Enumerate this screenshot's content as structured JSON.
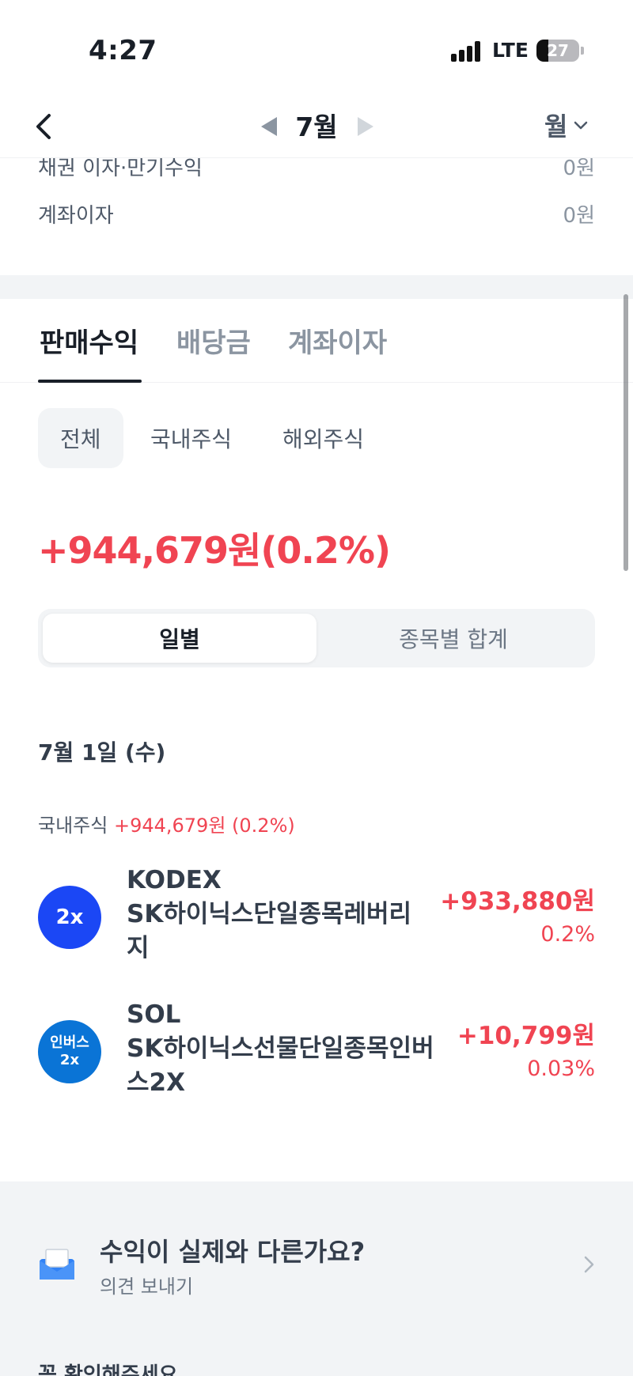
{
  "status_bar": {
    "time": "4:27",
    "network": "LTE",
    "battery": "27",
    "battery_level": 0.27
  },
  "nav": {
    "month": "7월",
    "period": "월"
  },
  "summary": [
    {
      "label": "채권 이자·만기수익",
      "value": "0원"
    },
    {
      "label": "계좌이자",
      "value": "0원"
    }
  ],
  "tabs": [
    {
      "label": "판매수익"
    },
    {
      "label": "배당금"
    },
    {
      "label": "계좌이자"
    }
  ],
  "chips": [
    {
      "label": "전체"
    },
    {
      "label": "국내주식"
    },
    {
      "label": "해외주식"
    }
  ],
  "total_profit": "+944,679원(0.2%)",
  "segment": [
    {
      "label": "일별"
    },
    {
      "label": "종목별 합계"
    }
  ],
  "day": {
    "date": "7월 1일 (수)",
    "market": "국내주식",
    "market_profit": "+944,679원 (0.2%)",
    "stocks": [
      {
        "logo": "2x",
        "name_line1": "KODEX",
        "name_line2": "SK하이닉스단일종목레버리",
        "name_line3": "지",
        "amount": "+933,880원",
        "percent": "0.2%",
        "logo_color": "#1b47f5"
      },
      {
        "logo_line1": "인버스",
        "logo_line2": "2x",
        "name_line1": "SOL",
        "name_line2": "SK하이닉스선물단일종목인버",
        "name_line3": "스2X",
        "amount": "+10,799원",
        "percent": "0.03%",
        "logo_color": "#0a74d6"
      }
    ]
  },
  "feedback": {
    "title": "수익이 실제와 다른가요?",
    "subtitle": "의견 보내기"
  },
  "bottom_heading": "꼭 확인해주세요"
}
